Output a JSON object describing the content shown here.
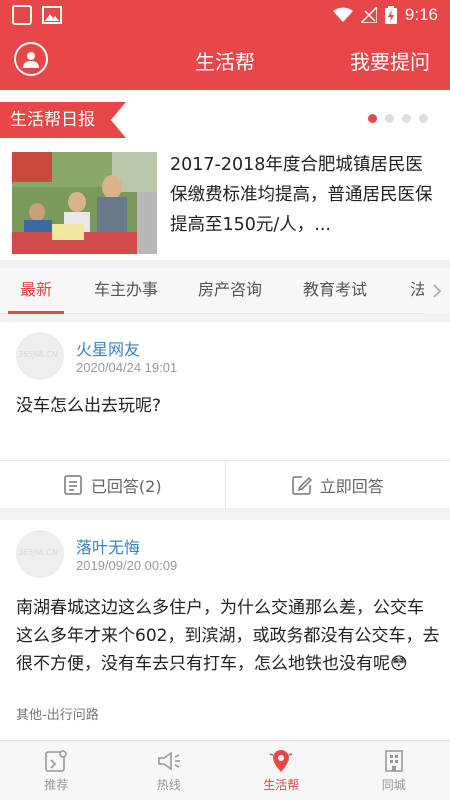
{
  "status_bar": {
    "time": "9:16"
  },
  "header": {
    "title": "生活帮",
    "ask_label": "我要提问"
  },
  "daily": {
    "tag": "生活帮日报",
    "news_text": "2017-2018年度合肥城镇居民医保缴费标准均提高，普通居民医保提高至150元/人，..."
  },
  "tabs": [
    "最新",
    "车主办事",
    "房产咨询",
    "教育考试",
    "法"
  ],
  "posts": [
    {
      "user": "火星网友",
      "time": "2020/04/24 19:01",
      "content": "没车怎么出去玩呢?",
      "avatar_watermark": "365JIA.CN",
      "answered_label": "已回答(2)",
      "answer_label": "立即回答"
    },
    {
      "user": "落叶无悔",
      "time": "2019/09/20 00:09",
      "content": "南湖春城这边这么多住户，为什么交通那么差，公交车这么多年才来个602，到滨湖，或政务都没有公交车，去很不方便，没有车去只有打车，怎么地铁也没有呢",
      "emoji": "😳",
      "avatar_watermark": "365JIA.CN",
      "category": "其他-出行问路"
    }
  ],
  "bottom_nav": [
    {
      "label": "推荐",
      "icon": "recommend-icon"
    },
    {
      "label": "热线",
      "icon": "megaphone-icon"
    },
    {
      "label": "生活帮",
      "icon": "location-pin-icon"
    },
    {
      "label": "同城",
      "icon": "building-icon"
    }
  ],
  "colors": {
    "accent": "#e8474a",
    "link": "#3a83c8"
  }
}
